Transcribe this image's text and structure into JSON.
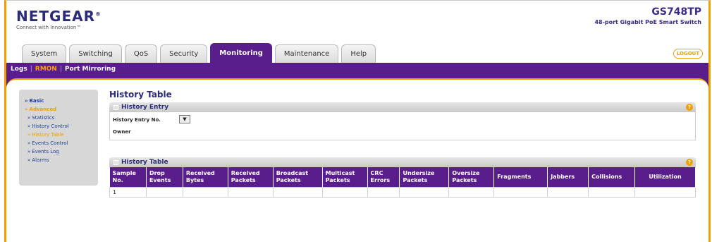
{
  "header": {
    "logo": "NETGEAR",
    "logo_tm": "®",
    "tagline": "Connect with Innovation™",
    "model": "GS748TP",
    "model_desc": "48-port Gigabit PoE Smart Switch"
  },
  "tabs": [
    {
      "label": "System"
    },
    {
      "label": "Switching"
    },
    {
      "label": "QoS"
    },
    {
      "label": "Security"
    },
    {
      "label": "Monitoring"
    },
    {
      "label": "Maintenance"
    },
    {
      "label": "Help"
    }
  ],
  "logout_label": "LOGOUT",
  "subnav": {
    "logs": "Logs",
    "rmon": "RMON",
    "port_mirroring": "Port Mirroring",
    "sep": "|"
  },
  "sidebar": {
    "basic": "Basic",
    "advanced": "Advanced",
    "statistics": "Statistics",
    "history_control": "History Control",
    "history_table": "History Table",
    "events_control": "Events Control",
    "events_log": "Events Log",
    "alarms": "Alarms"
  },
  "page_title": "History Table",
  "history_entry": {
    "title": "History Entry",
    "entry_no_label": "History Entry No.",
    "owner_label": "Owner",
    "select_arrow": "▼"
  },
  "history_table": {
    "title": "History Table",
    "columns": [
      "Sample No.",
      "Drop Events",
      "Received Bytes",
      "Received Packets",
      "Broadcast Packets",
      "Multicast Packets",
      "CRC Errors",
      "Undersize Packets",
      "Oversize Packets",
      "Fragments",
      "Jabbers",
      "Collisions",
      "Utilization"
    ],
    "rows": [
      [
        "1",
        "",
        "",
        "",
        "",
        "",
        "",
        "",
        "",
        "",
        "",
        "",
        ""
      ]
    ]
  },
  "help_glyph": "?",
  "colors": {
    "accent_purple": "#5a1e8c",
    "accent_orange": "#f0a000",
    "link_blue": "#1e3f99"
  }
}
